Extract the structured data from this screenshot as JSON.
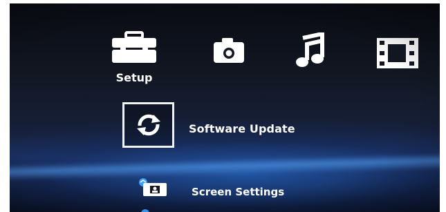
{
  "menu": {
    "categories": [
      {
        "label": "Setup",
        "icon": "toolbox-icon",
        "selected": true
      },
      {
        "label": "",
        "icon": "camera-icon"
      },
      {
        "label": "",
        "icon": "music-note-icon"
      },
      {
        "label": "",
        "icon": "film-icon"
      }
    ],
    "items": [
      {
        "label": "Software Update",
        "icon": "update-arrows-icon",
        "selected": true
      },
      {
        "label": "Screen Settings",
        "icon": "screen-settings-icon"
      }
    ]
  },
  "colors": {
    "background": "#121722",
    "highlight": "#3aa0ff",
    "text": "#ffffff"
  }
}
